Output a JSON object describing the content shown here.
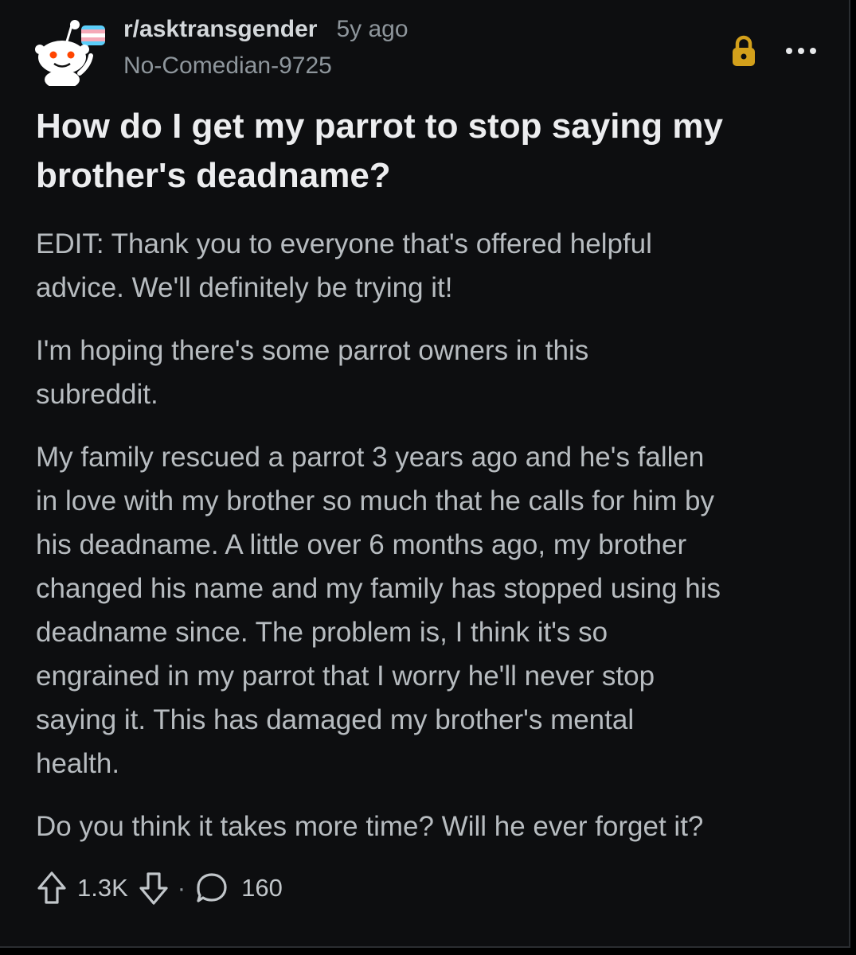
{
  "post": {
    "subreddit": "r/asktransgender",
    "age": "5y ago",
    "author": "No-Comedian-9725",
    "title_lines": [
      "How do I get my parrot to stop saying my",
      "brother's deadname?"
    ],
    "body": [
      [
        "EDIT: Thank you to everyone that's offered helpful",
        "advice. We'll definitely be trying it!"
      ],
      [
        "I'm hoping there's some parrot owners in this",
        "subreddit."
      ],
      [
        "My family rescued a parrot 3 years ago and he's fallen",
        "in love with my brother so much that he calls for him by",
        "his deadname. A little over 6 months ago, my brother",
        "changed his name and my family has stopped using his",
        "deadname since. The problem is, I think it's so",
        "engrained in my parrot that I worry he'll never stop",
        "saying it. This has damaged my brother's mental",
        "health."
      ],
      [
        "Do you think it takes more time? Will he ever forget it?"
      ]
    ],
    "score": "1.3K",
    "separator": "·",
    "comments": "160"
  },
  "icons": {
    "avatar": "reddit-snoo-avatar",
    "locked": "lock-icon",
    "more": "more-options-icon",
    "upvote": "upvote-arrow-icon",
    "downvote": "downvote-arrow-icon",
    "comments": "comment-bubble-icon"
  },
  "colors": {
    "background": "#0d0e10",
    "title": "#ecedef",
    "body_text": "#b7bcc0",
    "meta_text": "#8e969c",
    "lock": "#d3a01b",
    "trans_flag_blue": "#5bcefa",
    "trans_flag_pink": "#f5a9b8"
  }
}
